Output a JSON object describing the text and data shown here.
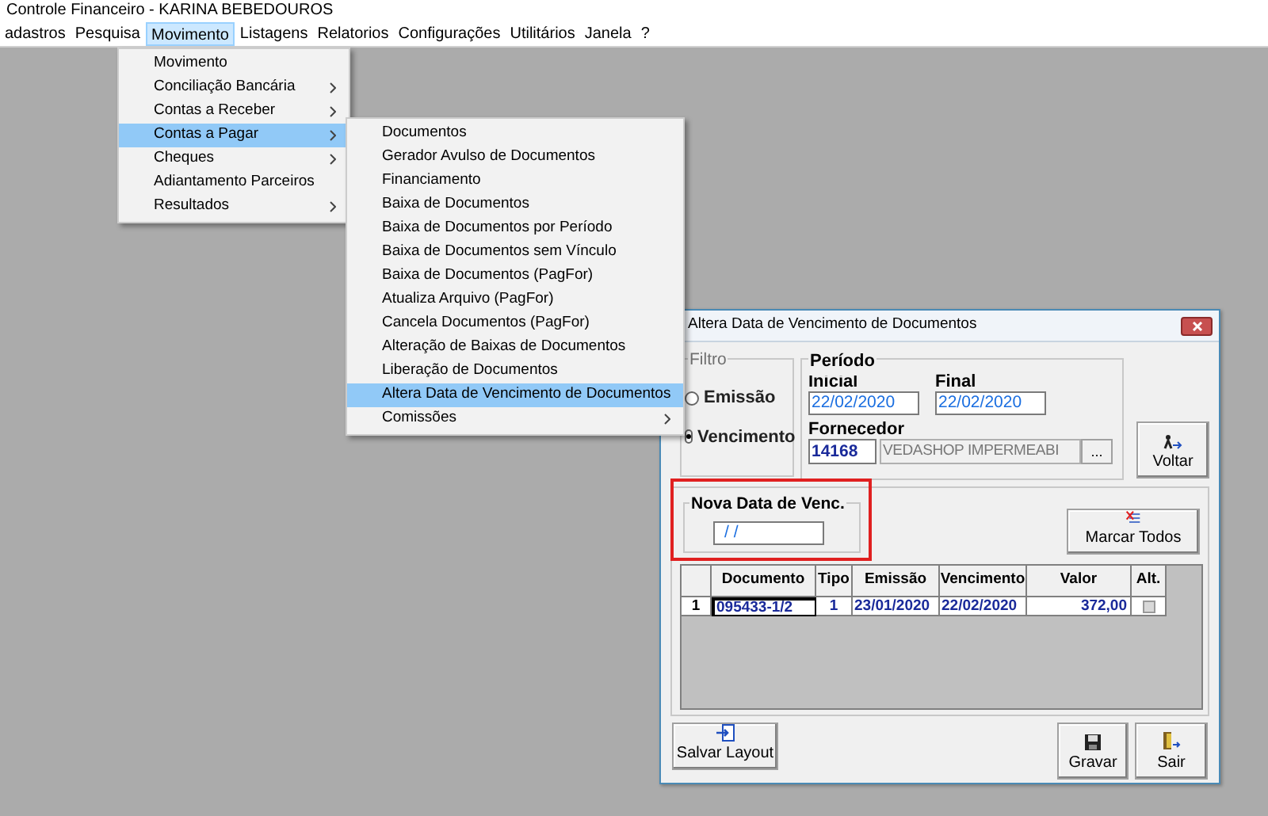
{
  "window": {
    "title": "Controle Financeiro - KARINA BEBEDOUROS"
  },
  "menubar": [
    {
      "label": "adastros",
      "selected": false
    },
    {
      "label": "Pesquisa",
      "selected": false
    },
    {
      "label": "Movimento",
      "selected": true
    },
    {
      "label": "Listagens",
      "selected": false
    },
    {
      "label": "Relatorios",
      "selected": false
    },
    {
      "label": "Configurações",
      "selected": false
    },
    {
      "label": "Utilitários",
      "selected": false
    },
    {
      "label": "Janela",
      "selected": false
    },
    {
      "label": "?",
      "selected": false
    }
  ],
  "menu": [
    {
      "label": "Movimento",
      "submenu": false,
      "selected": false
    },
    {
      "label": "Conciliação Bancária",
      "submenu": true,
      "selected": false
    },
    {
      "label": "Contas a Receber",
      "submenu": true,
      "selected": false
    },
    {
      "label": "Contas a Pagar",
      "submenu": true,
      "selected": true
    },
    {
      "label": "Cheques",
      "submenu": true,
      "selected": false
    },
    {
      "label": "Adiantamento Parceiros",
      "submenu": false,
      "selected": false
    },
    {
      "label": "Resultados",
      "submenu": true,
      "selected": false
    }
  ],
  "submenu": [
    {
      "label": "Documentos",
      "submenu": false,
      "selected": false
    },
    {
      "label": "Gerador Avulso de Documentos",
      "submenu": false,
      "selected": false
    },
    {
      "label": "Financiamento",
      "submenu": false,
      "selected": false
    },
    {
      "label": "Baixa de Documentos",
      "submenu": false,
      "selected": false
    },
    {
      "label": "Baixa de Documentos por Período",
      "submenu": false,
      "selected": false
    },
    {
      "label": "Baixa de Documentos sem Vínculo",
      "submenu": false,
      "selected": false
    },
    {
      "label": "Baixa de Documentos (PagFor)",
      "submenu": false,
      "selected": false
    },
    {
      "label": "Atualiza Arquivo (PagFor)",
      "submenu": false,
      "selected": false
    },
    {
      "label": "Cancela Documentos (PagFor)",
      "submenu": false,
      "selected": false
    },
    {
      "label": "Alteração de Baixas de Documentos",
      "submenu": false,
      "selected": false
    },
    {
      "label": "Liberação de Documentos",
      "submenu": false,
      "selected": false
    },
    {
      "label": "Altera Data de Vencimento de Documentos",
      "submenu": false,
      "selected": true
    },
    {
      "label": "Comissões",
      "submenu": true,
      "selected": false
    }
  ],
  "dialog": {
    "title": "Altera Data de Vencimento de Documentos",
    "filtro": {
      "label": "Filtro",
      "options": [
        {
          "label": "Emissão",
          "selected": false
        },
        {
          "label": "Vencimento",
          "selected": true
        }
      ]
    },
    "periodo": {
      "label": "Período",
      "inicial_label": "Inicial",
      "inicial": "22/02/2020",
      "final_label": "Final",
      "final": "22/02/2020"
    },
    "fornecedor": {
      "label": "Fornecedor",
      "code": "14168",
      "name": "VEDASHOP IMPERMEABI",
      "browse": "..."
    },
    "voltar": {
      "label": "Voltar"
    },
    "nova_data": {
      "label": "Nova Data de Venc.",
      "value": "/ /",
      "highlighted": true
    },
    "marcar": {
      "label": "Marcar Todos"
    },
    "table": {
      "columns": [
        "",
        "Documento",
        "Tipo",
        "Emissão",
        "Vencimento",
        "Valor",
        "Alt."
      ],
      "rows": [
        {
          "indicator": "1",
          "documento": "095433-1/2",
          "tipo": "1",
          "emissao": "23/01/2020",
          "vencimento": "22/02/2020",
          "valor": "372,00",
          "alt": false
        }
      ]
    },
    "salvar": {
      "label": "Salvar Layout"
    },
    "gravar": {
      "label": "Gravar"
    },
    "sair": {
      "label": "Sair"
    }
  }
}
